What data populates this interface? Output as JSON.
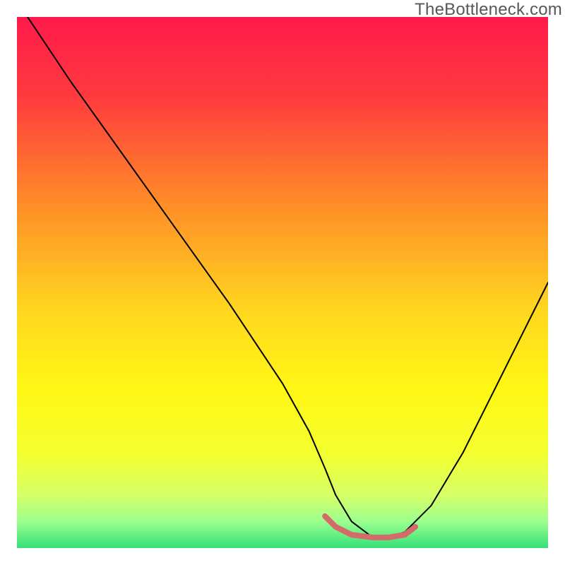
{
  "watermark": "TheBottleneck.com",
  "chart_data": {
    "type": "line",
    "title": "",
    "xlabel": "",
    "ylabel": "",
    "xlim": [
      0,
      100
    ],
    "ylim": [
      0,
      100
    ],
    "grid": false,
    "legend": false,
    "background_gradient_stops": [
      {
        "pos": 0.0,
        "color": "#ff1a4b"
      },
      {
        "pos": 0.15,
        "color": "#ff3a3e"
      },
      {
        "pos": 0.35,
        "color": "#ff8c28"
      },
      {
        "pos": 0.55,
        "color": "#ffd61f"
      },
      {
        "pos": 0.7,
        "color": "#fff714"
      },
      {
        "pos": 0.82,
        "color": "#f4ff2e"
      },
      {
        "pos": 0.9,
        "color": "#d6ff66"
      },
      {
        "pos": 0.95,
        "color": "#9bff8e"
      },
      {
        "pos": 1.0,
        "color": "#34e07a"
      }
    ],
    "series": [
      {
        "name": "bottleneck-curve",
        "stroke": "#000000",
        "stroke_width": 2,
        "x": [
          2,
          10,
          20,
          30,
          40,
          50,
          55,
          58,
          60,
          63,
          67,
          70,
          73,
          78,
          84,
          90,
          96,
          100
        ],
        "y": [
          100,
          88,
          74,
          60,
          46,
          31,
          22,
          15,
          10,
          5,
          2,
          2,
          3,
          8,
          18,
          30,
          42,
          50
        ]
      },
      {
        "name": "optimal-range-marker",
        "stroke": "#d46a6a",
        "stroke_width": 8,
        "x": [
          58,
          60,
          63,
          67,
          70,
          73,
          75
        ],
        "y": [
          6,
          4,
          2.5,
          2,
          2,
          2.5,
          4
        ]
      }
    ],
    "annotations": []
  }
}
